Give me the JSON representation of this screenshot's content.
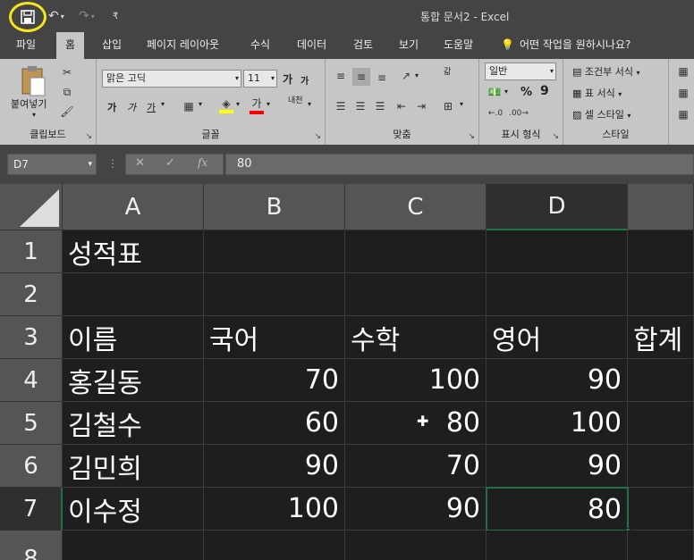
{
  "title_bar": {
    "title": "통합 문서2 - Excel",
    "qat": {
      "undo_icon": "↶",
      "redo_icon": "↷",
      "dropdown": "▾",
      "customize": "₹"
    }
  },
  "tabs": [
    {
      "label": "파일",
      "active": false
    },
    {
      "label": "홈",
      "active": true
    },
    {
      "label": "삽입",
      "active": false
    },
    {
      "label": "페이지 레이아웃",
      "active": false
    },
    {
      "label": "수식",
      "active": false
    },
    {
      "label": "데이터",
      "active": false
    },
    {
      "label": "검토",
      "active": false
    },
    {
      "label": "보기",
      "active": false
    },
    {
      "label": "도움말",
      "active": false
    }
  ],
  "tell_me": "어떤 작업을 원하시나요?",
  "ribbon": {
    "clipboard": {
      "paste_label": "붙여넣기",
      "group_label": "클립보드"
    },
    "font": {
      "font_name": "맑은 고딕",
      "font_size": "11",
      "grow": "가",
      "shrink": "가",
      "bold": "가",
      "italic": "가",
      "underline": "가",
      "font_color_glyph": "가",
      "phonetic": "내천",
      "group_label": "글꼴"
    },
    "alignment": {
      "wrap": "갋",
      "group_label": "맞춤"
    },
    "number": {
      "format": "일반",
      "percent": "%",
      "comma": "9",
      "group_label": "표시 형식"
    },
    "styles": {
      "conditional": "조건부 서식",
      "table": "표 서식",
      "cell": "셀 스타일",
      "group_label": "스타일"
    }
  },
  "formula_bar": {
    "name_box": "D7",
    "cancel": "✕",
    "enter": "✓",
    "fx": "fx",
    "value": "80"
  },
  "columns": [
    "A",
    "B",
    "C",
    "D"
  ],
  "rows": [
    "1",
    "2",
    "3",
    "4",
    "5",
    "6",
    "7",
    "8"
  ],
  "cells": {
    "A1": "성적표",
    "A3": "이름",
    "B3": "국어",
    "C3": "수학",
    "D3": "영어",
    "E3": "합계",
    "A4": "홍길동",
    "B4": "70",
    "C4": "100",
    "D4": "90",
    "A5": "김철수",
    "B5": "60",
    "C5": "80",
    "D5": "100",
    "A6": "김민희",
    "B6": "90",
    "C6": "70",
    "D6": "90",
    "A7": "이수정",
    "B7": "100",
    "C7": "90",
    "D7": "80"
  },
  "selection": "D7",
  "colors": {
    "accent": "#217346",
    "highlight_circle": "#f5e51c",
    "font_color": "#ff0000",
    "fill_color": "#ffff00"
  }
}
